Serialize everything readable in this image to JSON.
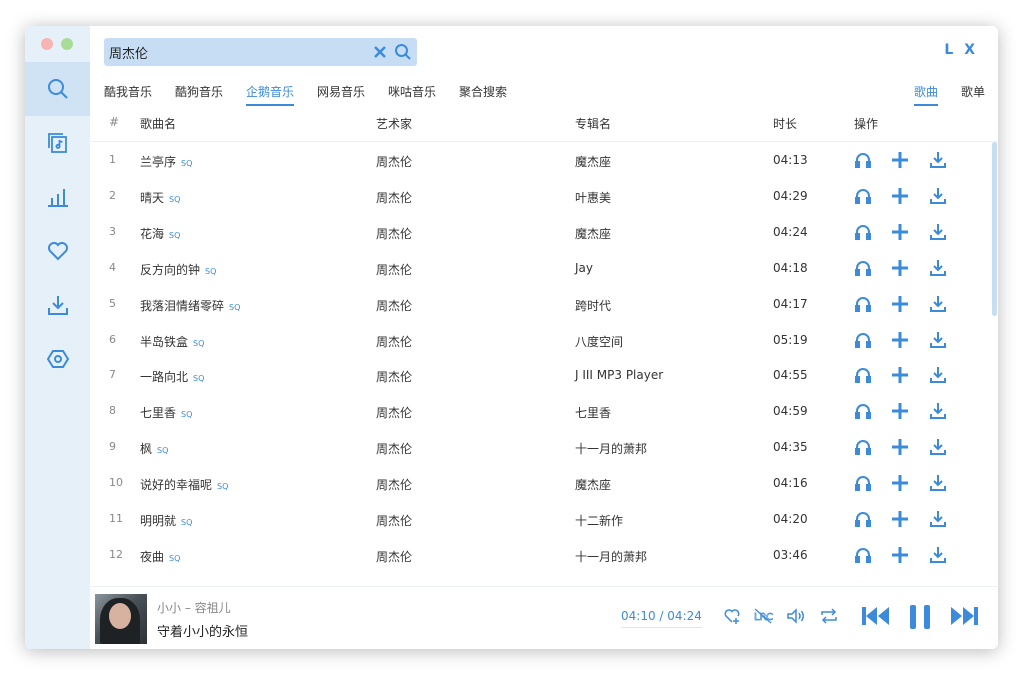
{
  "window": {
    "brand": "L X"
  },
  "search": {
    "value": "周杰伦"
  },
  "sidebar": {
    "items": [
      {
        "name": "search-icon",
        "active": true
      },
      {
        "name": "music-list-icon",
        "active": false
      },
      {
        "name": "bar-chart-icon",
        "active": false
      },
      {
        "name": "heart-icon",
        "active": false
      },
      {
        "name": "download-icon",
        "active": false
      },
      {
        "name": "settings-icon",
        "active": false
      }
    ]
  },
  "sources": [
    "酷我音乐",
    "酷狗音乐",
    "企鹅音乐",
    "网易音乐",
    "咪咕音乐",
    "聚合搜索"
  ],
  "active_source": "企鹅音乐",
  "types": [
    "歌曲",
    "歌单"
  ],
  "active_type": "歌曲",
  "columns": {
    "num": "#",
    "title": "歌曲名",
    "artist": "艺术家",
    "album": "专辑名",
    "duration": "时长",
    "ops": "操作"
  },
  "songs": [
    {
      "num": "1",
      "title": "兰亭序",
      "quality": "SQ",
      "artist": "周杰伦",
      "album": "魔杰座",
      "duration": "04:13"
    },
    {
      "num": "2",
      "title": "晴天",
      "quality": "SQ",
      "artist": "周杰伦",
      "album": "叶惠美",
      "duration": "04:29"
    },
    {
      "num": "3",
      "title": "花海",
      "quality": "SQ",
      "artist": "周杰伦",
      "album": "魔杰座",
      "duration": "04:24"
    },
    {
      "num": "4",
      "title": "反方向的钟",
      "quality": "SQ",
      "artist": "周杰伦",
      "album": "Jay",
      "duration": "04:18"
    },
    {
      "num": "5",
      "title": "我落泪情绪零碎",
      "quality": "SQ",
      "artist": "周杰伦",
      "album": "跨时代",
      "duration": "04:17"
    },
    {
      "num": "6",
      "title": "半岛铁盒",
      "quality": "SQ",
      "artist": "周杰伦",
      "album": "八度空间",
      "duration": "05:19"
    },
    {
      "num": "7",
      "title": "一路向北",
      "quality": "SQ",
      "artist": "周杰伦",
      "album": "J III MP3 Player",
      "duration": "04:55"
    },
    {
      "num": "8",
      "title": "七里香",
      "quality": "SQ",
      "artist": "周杰伦",
      "album": "七里香",
      "duration": "04:59"
    },
    {
      "num": "9",
      "title": "枫",
      "quality": "SQ",
      "artist": "周杰伦",
      "album": "十一月的萧邦",
      "duration": "04:35"
    },
    {
      "num": "10",
      "title": "说好的幸福呢",
      "quality": "SQ",
      "artist": "周杰伦",
      "album": "魔杰座",
      "duration": "04:16"
    },
    {
      "num": "11",
      "title": "明明就",
      "quality": "SQ",
      "artist": "周杰伦",
      "album": "十二新作",
      "duration": "04:20"
    },
    {
      "num": "12",
      "title": "夜曲",
      "quality": "SQ",
      "artist": "周杰伦",
      "album": "十一月的萧邦",
      "duration": "03:46"
    }
  ],
  "player": {
    "artist_line": "小小 – 容祖儿",
    "lyric": "守着小小的永恒",
    "current_time": "04:10",
    "separator": "/",
    "total_time": "04:24",
    "progress": 0.947
  },
  "colors": {
    "accent": "#3c8bdb",
    "sidebar_bg": "#e6f0f9",
    "search_bg": "#c7ddf3"
  }
}
